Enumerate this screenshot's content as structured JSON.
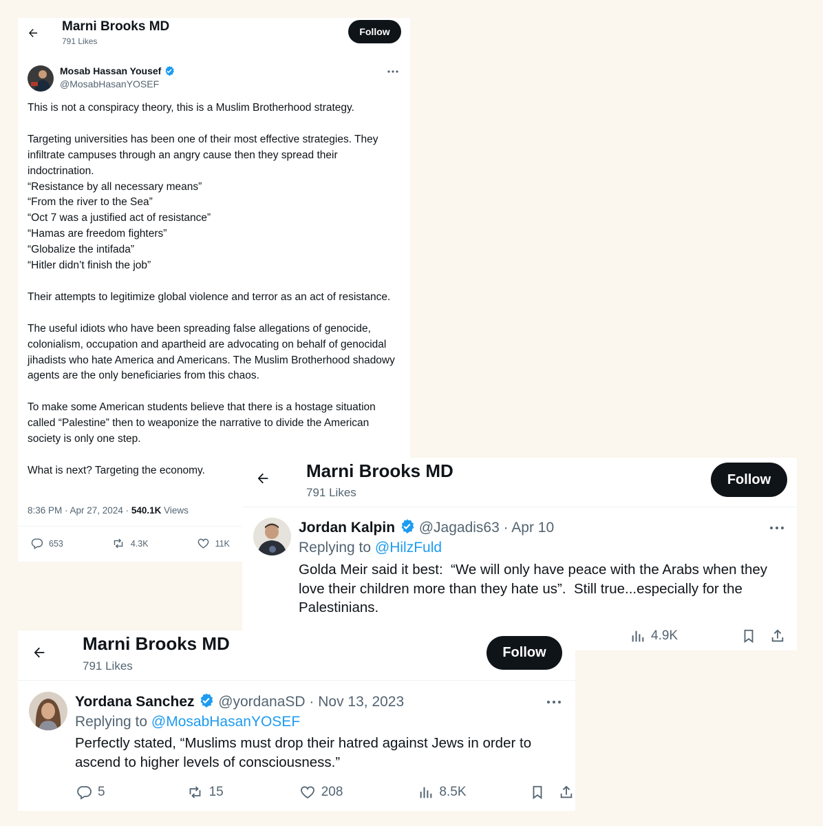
{
  "card1": {
    "header": {
      "name": "Marni Brooks MD",
      "likes": "791 Likes",
      "follow": "Follow"
    },
    "tweet": {
      "display_name": "Mosab Hassan Yousef",
      "handle": "@MosabHasanYOSEF",
      "text": "This is not a conspiracy theory, this is a Muslim Brotherhood strategy.\n\nTargeting universities has been one of their most effective strategies. They infiltrate campuses through an angry cause then they spread their indoctrination.\n“Resistance by all necessary means”\n“From the river to the Sea”\n“Oct 7 was a justified act of resistance”\n“Hamas are freedom fighters”\n“Globalize the intifada”\n“Hitler didn’t finish the job”\n\nTheir attempts to legitimize global violence and terror as an act of resistance.\n\nThe useful idiots who have been spreading false allegations of genocide, colonialism, occupation and apartheid are advocating on behalf of genocidal jihadists who hate America and Americans. The Muslim Brotherhood shadowy agents are the only beneficiaries from this chaos.\n\nTo make some American students believe that there is a hostage situation called “Palestine” then to weaponize the narrative to divide the American society is only one step.\n\nWhat is next? Targeting the economy.",
      "timestamp": "8:36 PM · Apr 27, 2024 · ",
      "views_count": "540.1K",
      "views_label": " Views",
      "replies": "653",
      "reposts": "4.3K",
      "likes": "11K"
    }
  },
  "card2": {
    "header": {
      "name": "Marni Brooks MD",
      "likes": "791 Likes",
      "follow": "Follow"
    },
    "tweet": {
      "display_name": "Jordan Kalpin",
      "handle": "@Jagadis63",
      "date": " · Apr 10",
      "replying_prefix": "Replying to ",
      "replying_to": "@HilzFuld",
      "text": "Golda Meir said it best:  “We will only have peace with the Arabs when they love their children more than they hate us”.  Still true...especially for the Palestinians.",
      "views": "4.9K"
    }
  },
  "card3": {
    "header": {
      "name": "Marni Brooks MD",
      "likes": "791 Likes",
      "follow": "Follow"
    },
    "tweet": {
      "display_name": "Yordana Sanchez",
      "handle": "@yordanaSD",
      "date": " · Nov 13, 2023",
      "replying_prefix": "Replying to ",
      "replying_to": "@MosabHasanYOSEF",
      "text": "Perfectly stated, “Muslims must drop their hatred against Jews in order to ascend to higher levels of consciousness.”",
      "replies": "5",
      "reposts": "15",
      "likes": "208",
      "views": "8.5K"
    }
  },
  "colors": {
    "accent": "#1d9bf0",
    "text": "#0f1419",
    "muted": "#536471",
    "background": "#fbf6ee"
  }
}
